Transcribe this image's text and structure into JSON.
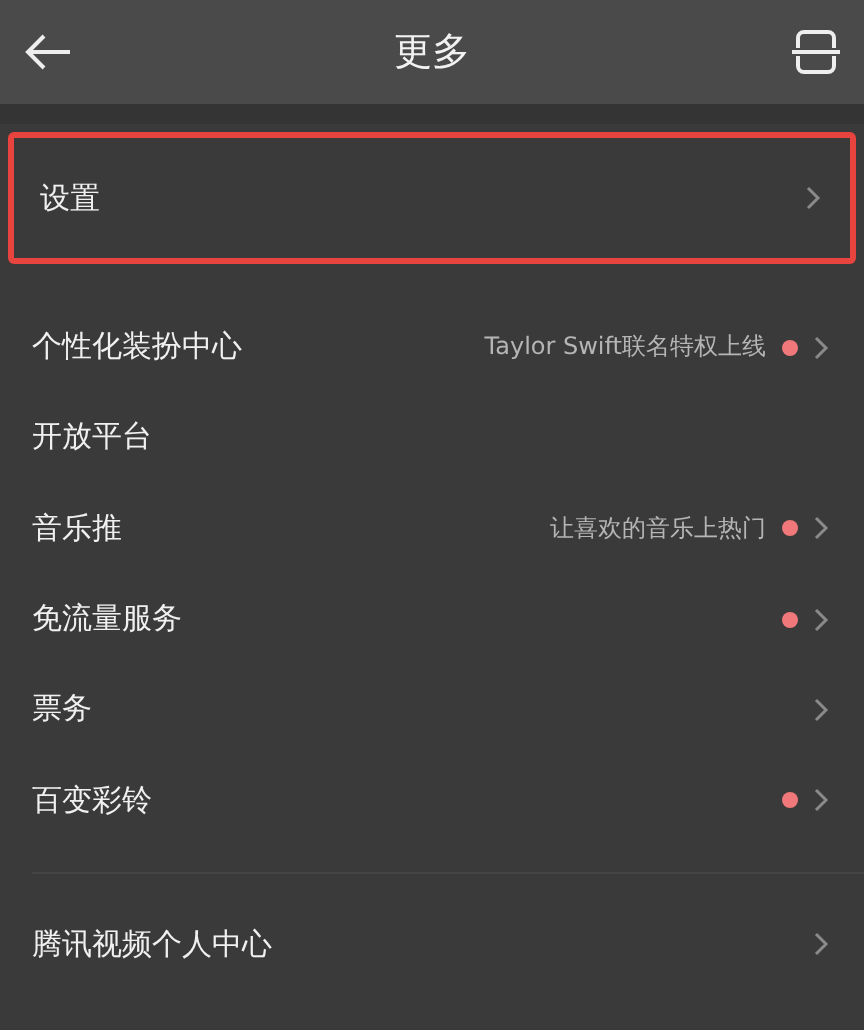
{
  "header": {
    "title": "更多"
  },
  "sections": [
    {
      "highlighted": true,
      "items": [
        {
          "label": "设置",
          "dot": false,
          "chevron": true
        }
      ]
    },
    {
      "highlighted": false,
      "items": [
        {
          "label": "个性化装扮中心",
          "hint": "Taylor Swift联名特权上线",
          "dot": true,
          "chevron": true
        },
        {
          "label": "开放平台",
          "dot": false,
          "chevron": false
        },
        {
          "label": "音乐推",
          "hint": "让喜欢的音乐上热门",
          "dot": true,
          "chevron": true
        },
        {
          "label": "免流量服务",
          "dot": true,
          "chevron": true
        },
        {
          "label": "票务",
          "dot": false,
          "chevron": true
        },
        {
          "label": "百变彩铃",
          "dot": true,
          "chevron": true
        }
      ]
    },
    {
      "highlighted": false,
      "items": [
        {
          "label": "腾讯视频个人中心",
          "dot": false,
          "chevron": true
        }
      ]
    }
  ]
}
